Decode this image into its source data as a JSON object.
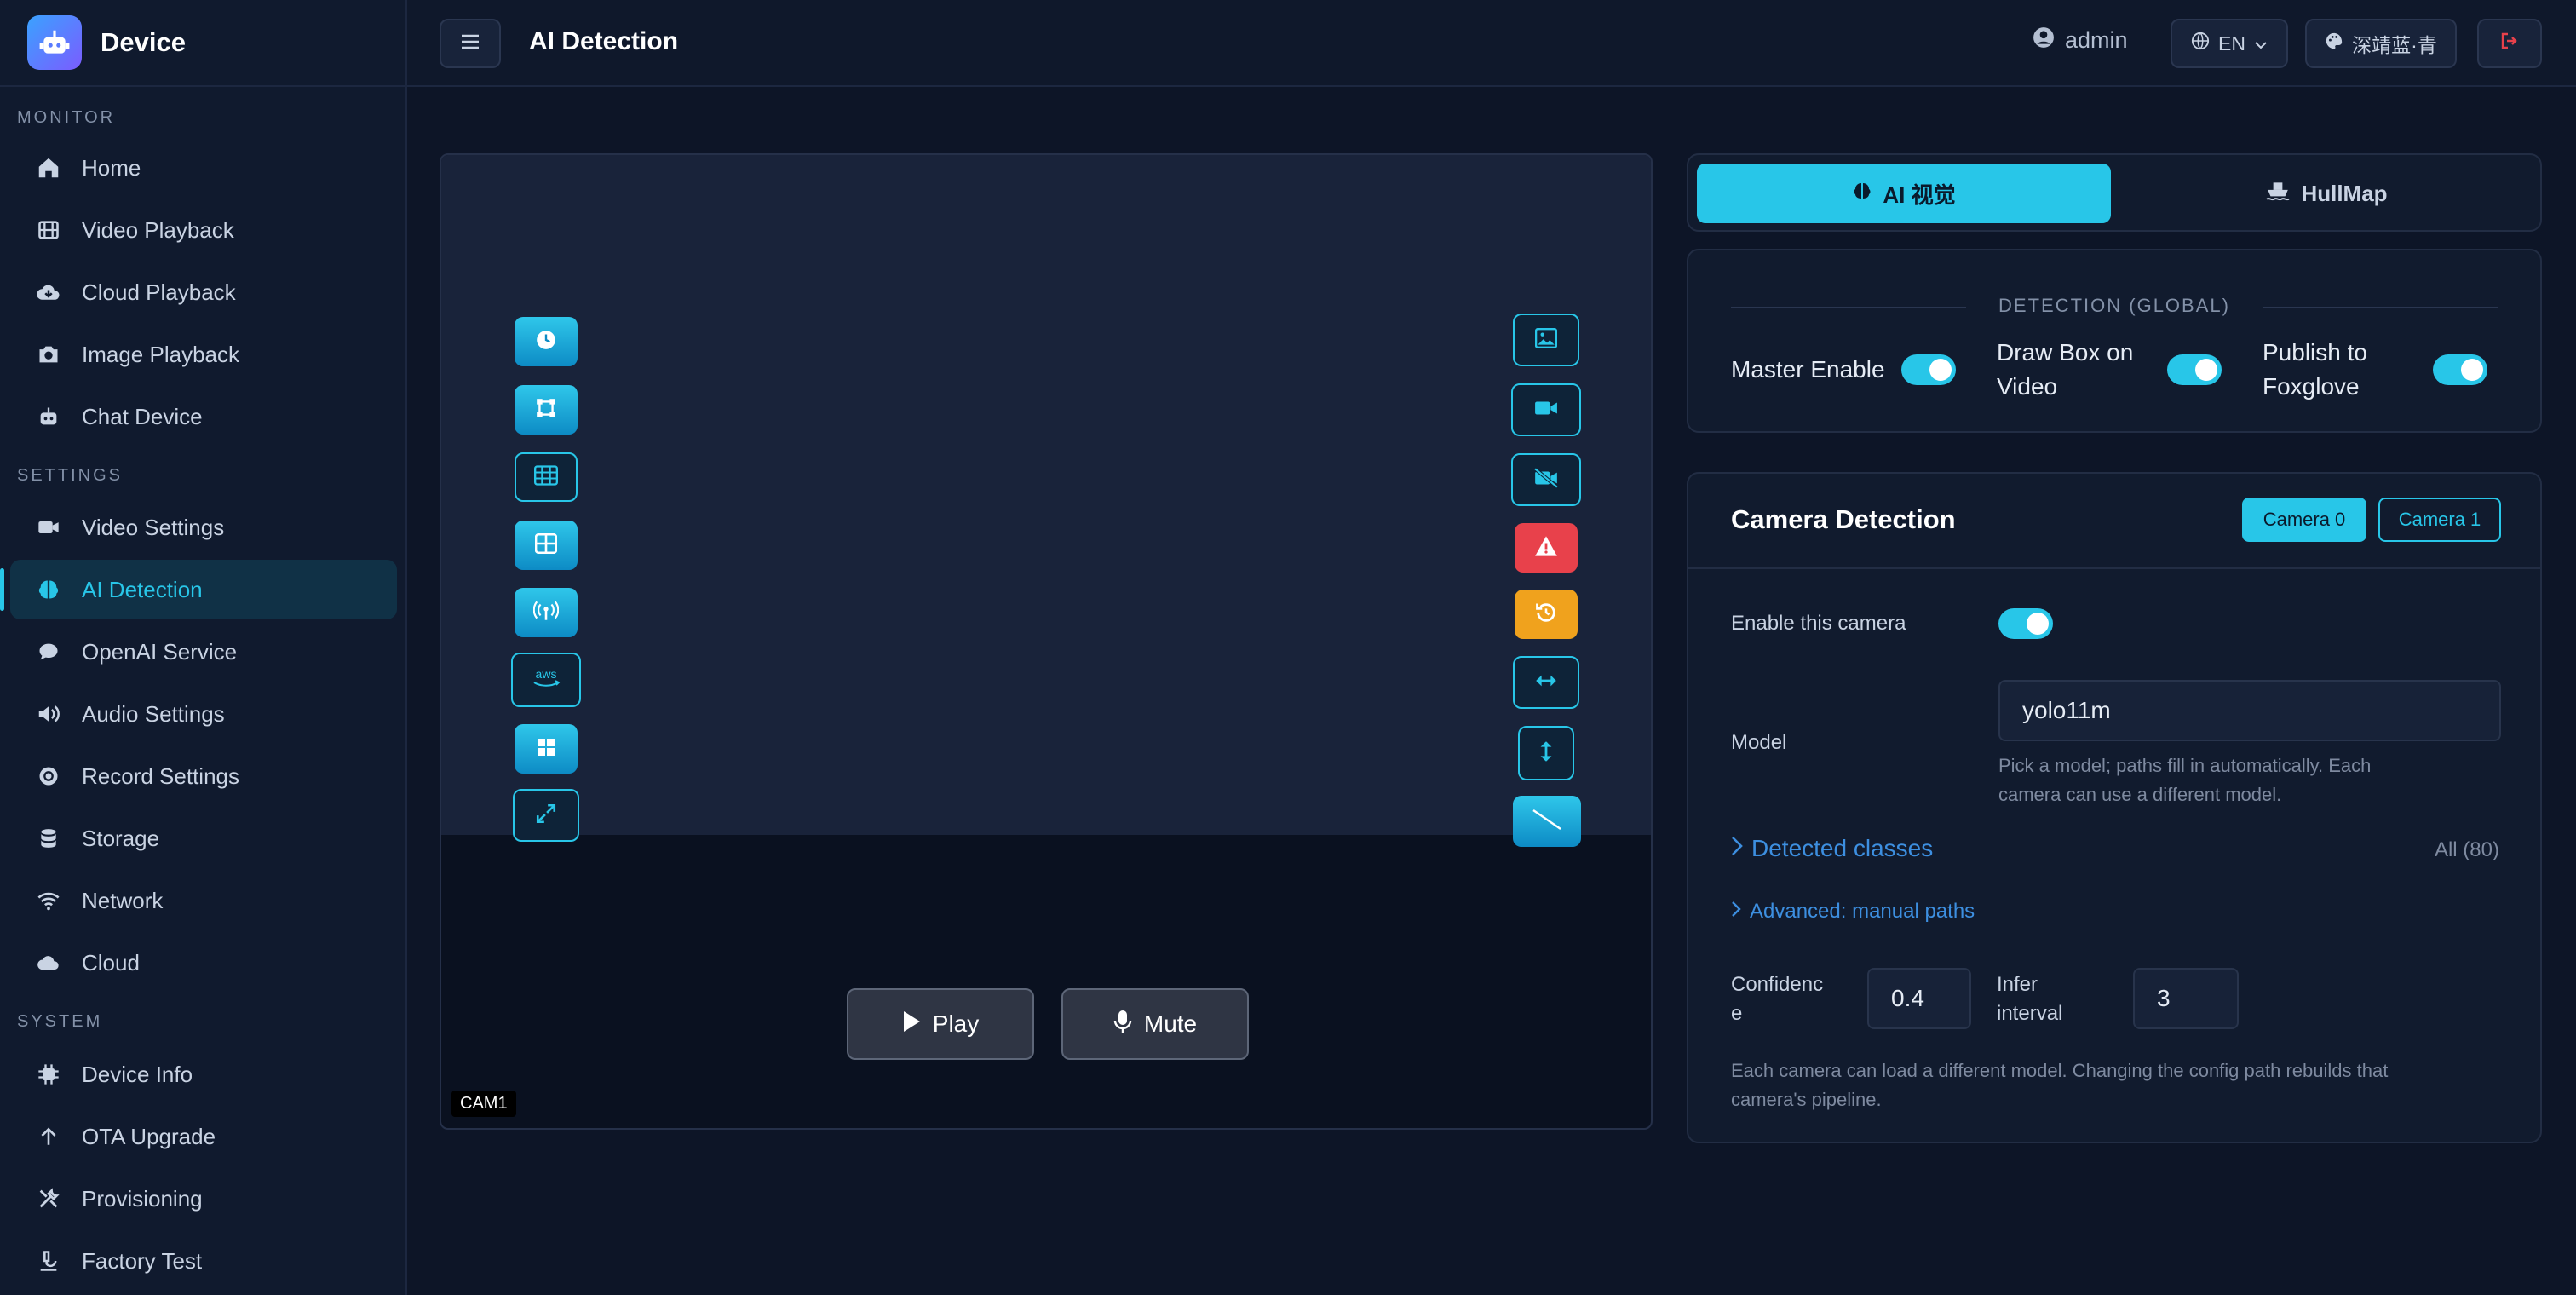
{
  "brand": {
    "name": "Device"
  },
  "sidebar": {
    "sections": [
      {
        "title": "MONITOR",
        "items": [
          {
            "label": "Home",
            "icon": "home-icon"
          },
          {
            "label": "Video Playback",
            "icon": "film-icon"
          },
          {
            "label": "Cloud Playback",
            "icon": "cloud-download-icon"
          },
          {
            "label": "Image Playback",
            "icon": "camera-icon"
          },
          {
            "label": "Chat Device",
            "icon": "robot-icon"
          }
        ]
      },
      {
        "title": "SETTINGS",
        "items": [
          {
            "label": "Video Settings",
            "icon": "video-icon"
          },
          {
            "label": "AI Detection",
            "icon": "brain-icon",
            "active": true
          },
          {
            "label": "OpenAI Service",
            "icon": "chat-icon"
          },
          {
            "label": "Audio Settings",
            "icon": "speaker-icon"
          },
          {
            "label": "Record Settings",
            "icon": "record-icon"
          },
          {
            "label": "Storage",
            "icon": "database-icon"
          },
          {
            "label": "Network",
            "icon": "wifi-icon"
          },
          {
            "label": "Cloud",
            "icon": "cloud-icon"
          }
        ]
      },
      {
        "title": "SYSTEM",
        "items": [
          {
            "label": "Device Info",
            "icon": "chip-icon"
          },
          {
            "label": "OTA Upgrade",
            "icon": "arrow-up-icon"
          },
          {
            "label": "Provisioning",
            "icon": "tools-icon"
          },
          {
            "label": "Factory Test",
            "icon": "microscope-icon"
          }
        ]
      }
    ]
  },
  "header": {
    "title": "AI Detection",
    "user": "admin",
    "language": "EN",
    "theme": "深靖蓝·青"
  },
  "video": {
    "play_label": "Play",
    "mute_label": "Mute",
    "camera_label": "CAM1"
  },
  "tabs": {
    "ai": "AI 视觉",
    "hullmap": "HullMap"
  },
  "detection": {
    "section_title": "DETECTION (GLOBAL)",
    "master_enable": "Master Enable",
    "draw_box_1": "Draw Box on",
    "draw_box_2": "Video",
    "publish_1": "Publish to",
    "publish_2": "Foxglove"
  },
  "camera_detection": {
    "title": "Camera Detection",
    "camera0": "Camera 0",
    "camera1": "Camera 1",
    "enable_label": "Enable this camera",
    "model_label": "Model",
    "model_value": "yolo11m",
    "model_hint_1": "Pick a model; paths fill in automatically. Each",
    "model_hint_2": "camera can use a different model.",
    "classes_label": "Detected classes",
    "classes_count": "All (80)",
    "advanced_label": "Advanced: manual paths",
    "confidence_label_1": "Confidenc",
    "confidence_label_2": "e",
    "confidence_value": "0.4",
    "infer_label_1": "Infer",
    "infer_label_2": "interval",
    "infer_value": "3",
    "footer_1": "Each camera can load a different model. Changing the config path rebuilds that",
    "footer_2": "camera's pipeline."
  },
  "colors": {
    "accent": "#28c6e8",
    "danger": "#e8414b",
    "warning": "#f0a21d"
  }
}
